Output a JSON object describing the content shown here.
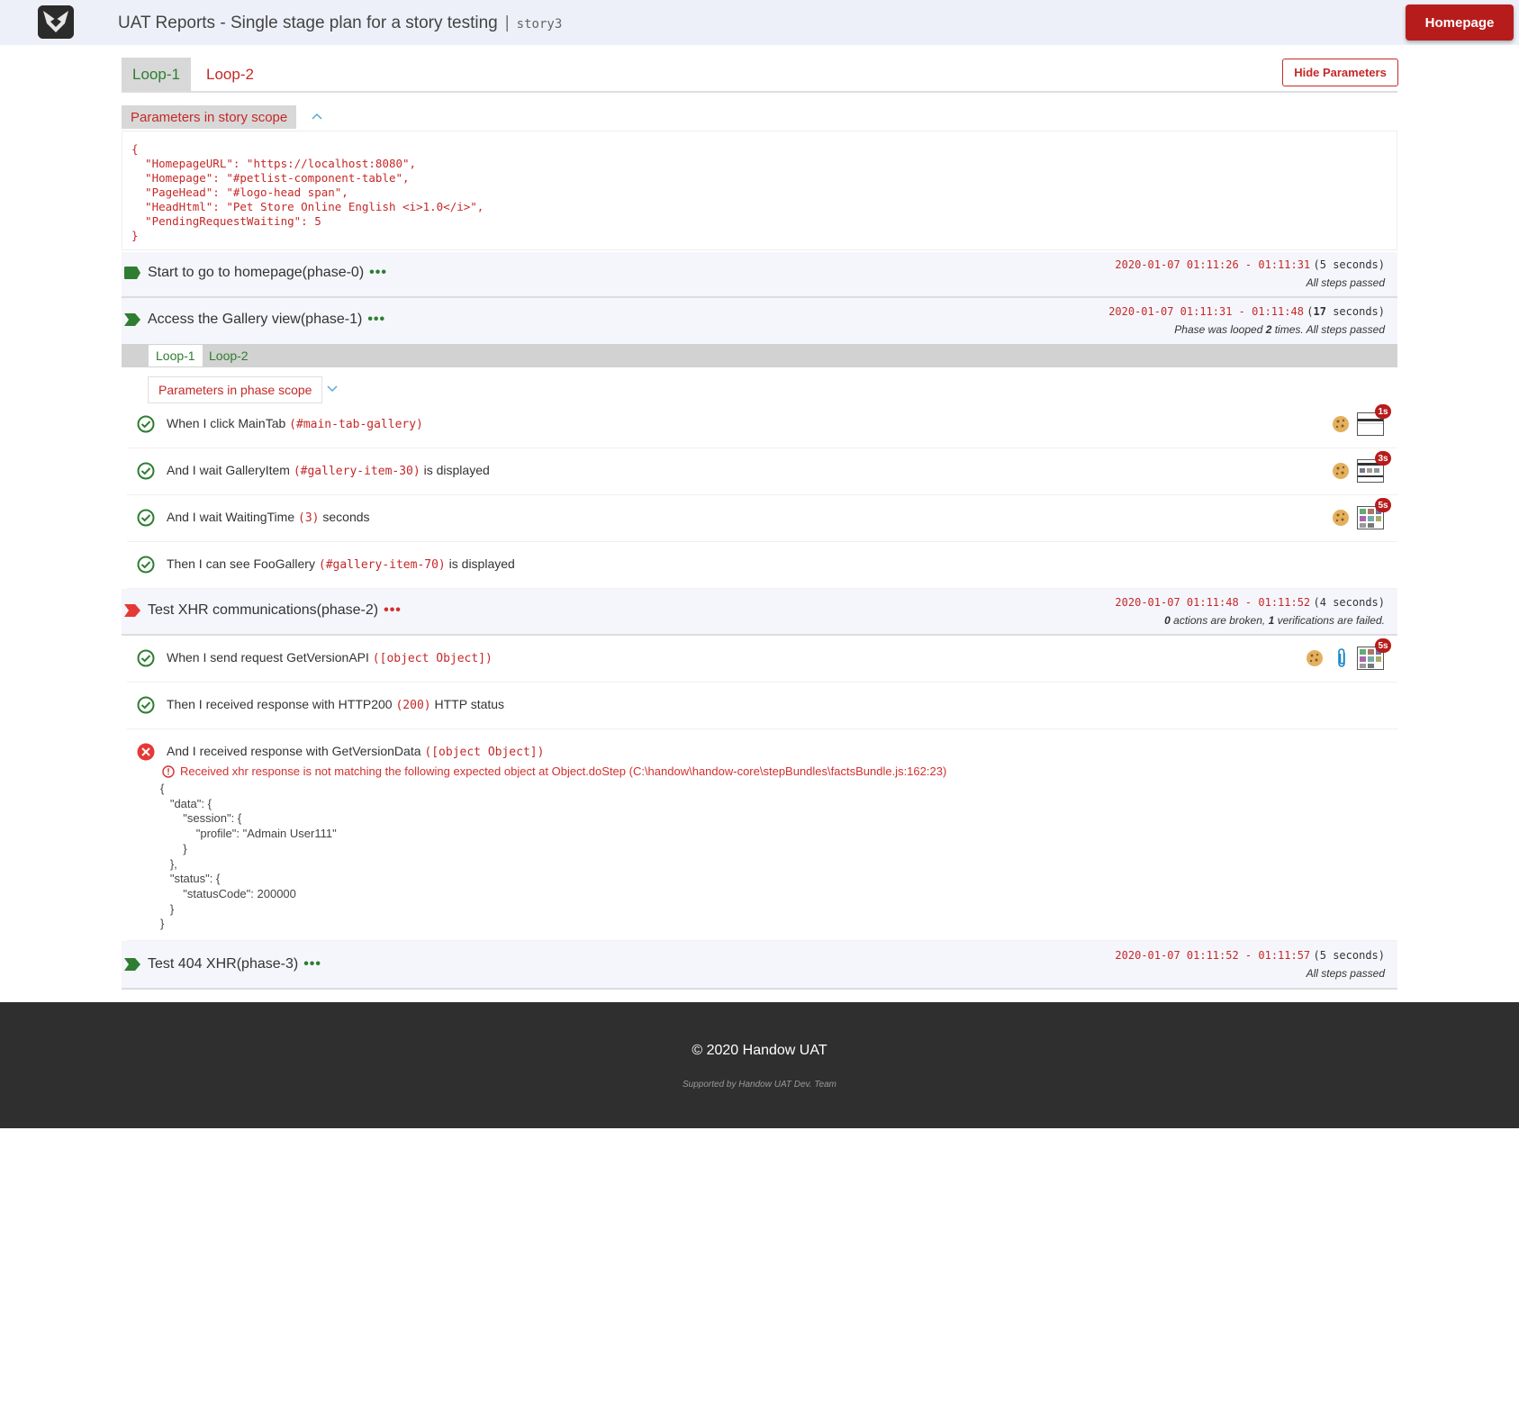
{
  "header": {
    "title": "UAT Reports - Single stage plan for a story testing",
    "separator": "|",
    "story": "story3",
    "homepage_button": "Homepage"
  },
  "story_loops": [
    {
      "label": "Loop-1",
      "active": true
    },
    {
      "label": "Loop-2",
      "active": false
    }
  ],
  "hide_parameters_button": "Hide Parameters",
  "story_scope": {
    "label": "Parameters in story scope",
    "json": "{\n  \"HomepageURL\": \"https://localhost:8080\",\n  \"Homepage\": \"#petlist-component-table\",\n  \"PageHead\": \"#logo-head span\",\n  \"HeadHtml\": \"Pet Store Online English <i>1.0</i>\",\n  \"PendingRequestWaiting\": 5\n}"
  },
  "phases": [
    {
      "title": "Start to go to homepage(phase-0)",
      "dots": "•••",
      "time_range": "2020-01-07 01:11:26 - 01:11:31",
      "duration": "(5 seconds)",
      "summary": "All steps passed"
    },
    {
      "title": "Access the Gallery view(phase-1)",
      "dots": "•••",
      "time_range": "2020-01-07 01:11:31 - 01:11:48",
      "duration_prefix": "(",
      "duration_num": "17",
      "duration_suffix": " seconds)",
      "summary_prefix": "Phase was looped ",
      "summary_num": "2",
      "summary_suffix": " times. All steps passed",
      "loops": [
        "Loop-1",
        "Loop-2"
      ],
      "scope_label": "Parameters in phase scope",
      "steps": [
        {
          "prefix": "When I click MainTab ",
          "arg": "(#main-tab-gallery)",
          "suffix": "",
          "badge": "1s"
        },
        {
          "prefix": "And I wait GalleryItem ",
          "arg": "(#gallery-item-30)",
          "suffix": " is displayed",
          "badge": "3s"
        },
        {
          "prefix": "And I wait WaitingTime ",
          "arg": "(3)",
          "suffix": " seconds",
          "badge": "5s"
        },
        {
          "prefix": "Then I can see FooGallery ",
          "arg": "(#gallery-item-70)",
          "suffix": " is displayed"
        }
      ]
    },
    {
      "title": "Test XHR communications(phase-2)",
      "dots": "•••",
      "time_range": "2020-01-07 01:11:48 - 01:11:52",
      "duration": "(4 seconds)",
      "summary_num1": "0",
      "summary_mid": " actions are broken, ",
      "summary_num2": "1",
      "summary_end": " verifications are failed.",
      "steps": [
        {
          "prefix": "When I send request GetVersionAPI ",
          "arg": "([object Object])",
          "suffix": "",
          "badge": "5s"
        },
        {
          "prefix": "Then I received response with HTTP200 ",
          "arg": "(200)",
          "suffix": " HTTP status"
        },
        {
          "prefix": "And I received response with GetVersionData ",
          "arg": "([object Object])",
          "suffix": ""
        }
      ],
      "error_message": "Received xhr response is not matching the following expected object at Object.doStep (C:\\handow\\handow-core\\stepBundles\\factsBundle.js:162:23)",
      "error_json": "{\n   \"data\": {\n       \"session\": {\n           \"profile\": \"Admain User111\"\n       }\n   },\n   \"status\": {\n       \"statusCode\": 200000\n   }\n}"
    },
    {
      "title": "Test 404 XHR(phase-3)",
      "dots": "•••",
      "time_range": "2020-01-07 01:11:52 - 01:11:57",
      "duration": "(5 seconds)",
      "summary": "All steps passed"
    }
  ],
  "footer": {
    "copyright": "© 2020 Handow UAT",
    "supported": "Supported by Handow UAT Dev. Team"
  },
  "colors": {
    "accent_red": "#b71c1c",
    "pass_green": "#2e7d32",
    "fail_red": "#d32f2f",
    "header_bg": "#eef0f9",
    "footer_bg": "#2f2f2f"
  }
}
